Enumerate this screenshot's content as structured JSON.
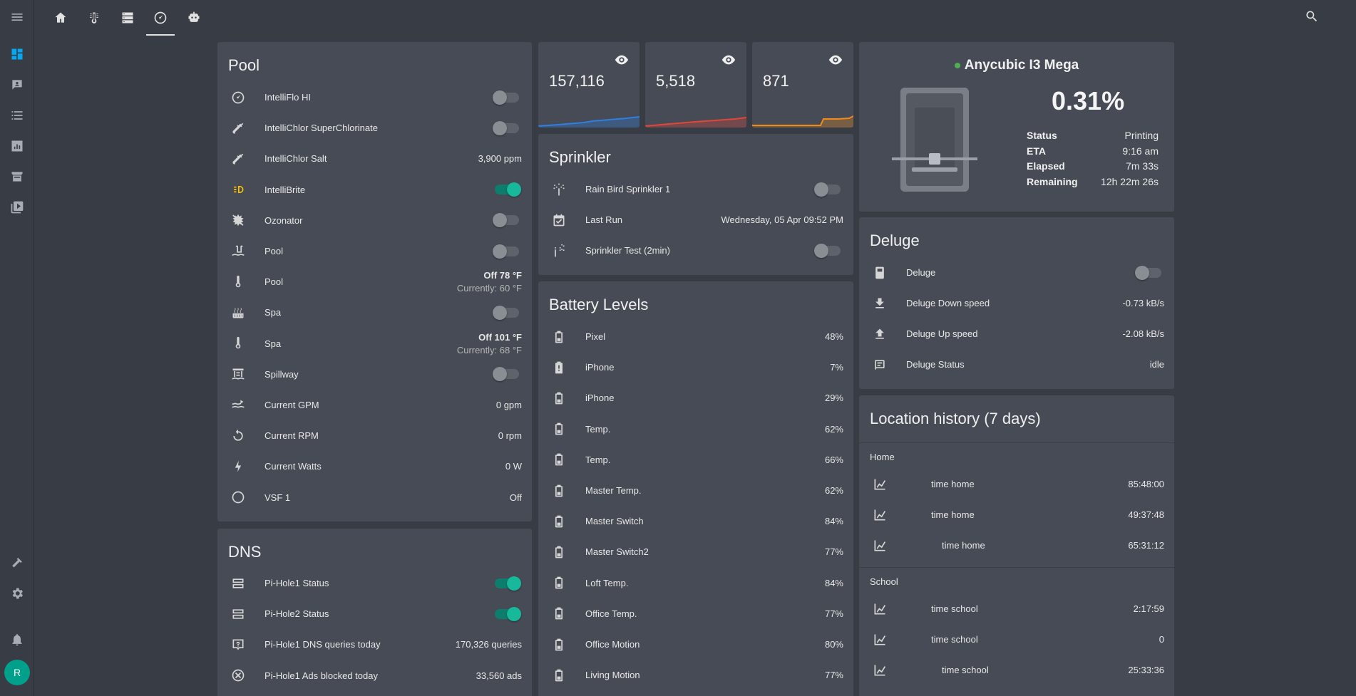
{
  "sidebar": {
    "items": [
      "dashboard-icon",
      "map-icon",
      "logbook-icon",
      "history-icon",
      "hacs-icon",
      "media-icon",
      "developer-tools-icon",
      "settings-icon",
      "notifications-icon"
    ],
    "avatar_initial": "R"
  },
  "tabs": [
    "home-icon",
    "thermostat-icon",
    "server-icon",
    "gauge-icon",
    "robot-icon"
  ],
  "pool": {
    "title": "Pool",
    "rows": [
      {
        "name": "IntelliFlo HI",
        "type": "toggle",
        "on": false
      },
      {
        "name": "IntelliChlor SuperChlorinate",
        "type": "toggle",
        "on": false
      },
      {
        "name": "IntelliChlor Salt",
        "type": "value",
        "value": "3,900 ppm"
      },
      {
        "name": "IntelliBrite",
        "type": "toggle",
        "on": true
      },
      {
        "name": "Ozonator",
        "type": "toggle",
        "on": false
      },
      {
        "name": "Pool",
        "type": "toggle",
        "on": false
      },
      {
        "name": "Pool",
        "type": "thermo",
        "value": "Off 78 °F",
        "sub": "Currently: 60 °F"
      },
      {
        "name": "Spa",
        "type": "toggle",
        "on": false
      },
      {
        "name": "Spa",
        "type": "thermo",
        "value": "Off 101 °F",
        "sub": "Currently: 68 °F"
      },
      {
        "name": "Spillway",
        "type": "toggle",
        "on": false
      },
      {
        "name": "Current GPM",
        "type": "value",
        "value": "0 gpm"
      },
      {
        "name": "Current RPM",
        "type": "value",
        "value": "0 rpm"
      },
      {
        "name": "Current Watts",
        "type": "value",
        "value": "0 W"
      },
      {
        "name": "VSF 1",
        "type": "value",
        "value": "Off"
      }
    ]
  },
  "dns": {
    "title": "DNS",
    "rows": [
      {
        "name": "Pi-Hole1 Status",
        "type": "toggle",
        "on": true
      },
      {
        "name": "Pi-Hole2 Status",
        "type": "toggle",
        "on": true
      },
      {
        "name": "Pi-Hole1 DNS queries today",
        "type": "value",
        "value": "170,326 queries"
      },
      {
        "name": "Pi-Hole1 Ads blocked today",
        "type": "value",
        "value": "33,560 ads"
      }
    ]
  },
  "stats": [
    {
      "value": "157,116",
      "color": "#2f7fe0"
    },
    {
      "value": "5,518",
      "color": "#e0463a"
    },
    {
      "value": "871",
      "color": "#f08a1a"
    }
  ],
  "sprinkler": {
    "title": "Sprinkler",
    "rows": [
      {
        "name": "Rain Bird Sprinkler 1",
        "type": "toggle",
        "on": false
      },
      {
        "name": "Last Run",
        "type": "value",
        "value": "Wednesday, 05 Apr 09:52 PM"
      },
      {
        "name": "Sprinkler Test (2min)",
        "type": "toggle",
        "on": false
      }
    ]
  },
  "battery": {
    "title": "Battery Levels",
    "rows": [
      {
        "name": "Pixel",
        "value": "48%"
      },
      {
        "name": "iPhone",
        "value": "7%"
      },
      {
        "name": "iPhone",
        "value": "29%"
      },
      {
        "name": "Temp.",
        "value": "62%"
      },
      {
        "name": "Temp.",
        "value": "66%"
      },
      {
        "name": "Master Temp.",
        "value": "62%"
      },
      {
        "name": "Master Switch",
        "value": "84%"
      },
      {
        "name": "Master Switch2",
        "value": "77%"
      },
      {
        "name": "Loft Temp.",
        "value": "84%"
      },
      {
        "name": "Office Temp.",
        "value": "77%"
      },
      {
        "name": "Office Motion",
        "value": "80%"
      },
      {
        "name": "Living Motion",
        "value": "77%"
      }
    ]
  },
  "printer": {
    "name": "Anycubic I3 Mega",
    "progress": "0.31%",
    "progress_fraction": 0.0031,
    "status_color": "#4caf50",
    "details": [
      {
        "label": "Status",
        "value": "Printing"
      },
      {
        "label": "ETA",
        "value": "9:16 am"
      },
      {
        "label": "Elapsed",
        "value": "7m 33s"
      },
      {
        "label": "Remaining",
        "value": "12h 22m 26s"
      }
    ]
  },
  "deluge": {
    "title": "Deluge",
    "rows": [
      {
        "name": "Deluge",
        "type": "toggle",
        "on": false
      },
      {
        "name": "Deluge Down speed",
        "type": "value",
        "value": "-0.73 kB/s"
      },
      {
        "name": "Deluge Up speed",
        "type": "value",
        "value": "-2.08 kB/s"
      },
      {
        "name": "Deluge Status",
        "type": "value",
        "value": "idle"
      }
    ]
  },
  "location": {
    "title": "Location history (7 days)",
    "groups": [
      {
        "label": "Home",
        "rows": [
          {
            "name": "time home",
            "value": "85:48:00"
          },
          {
            "name": "time home",
            "value": "49:37:48"
          },
          {
            "name": "time home",
            "value": "65:31:12"
          }
        ]
      },
      {
        "label": "School",
        "rows": [
          {
            "name": "time school",
            "value": "2:17:59"
          },
          {
            "name": "time school",
            "value": "0"
          },
          {
            "name": "time school",
            "value": "25:33:36"
          }
        ]
      }
    ]
  }
}
